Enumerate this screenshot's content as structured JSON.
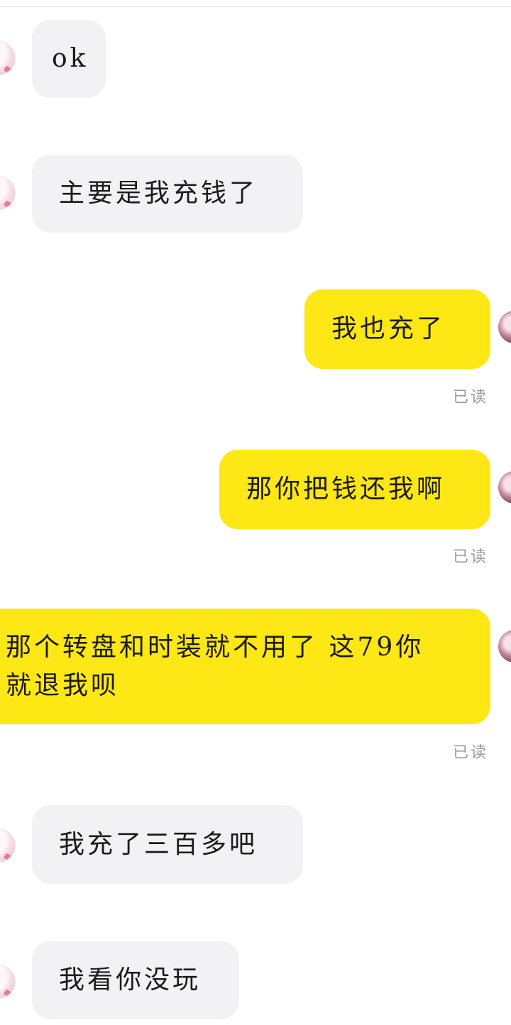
{
  "messages": [
    {
      "id": "m1",
      "side": "incoming",
      "text": "ok"
    },
    {
      "id": "m2",
      "side": "incoming",
      "text": "主要是我充钱了"
    },
    {
      "id": "m3",
      "side": "outgoing",
      "text": "我也充了",
      "status": "已读"
    },
    {
      "id": "m4",
      "side": "outgoing",
      "text": "那你把钱还我啊",
      "status": "已读"
    },
    {
      "id": "m5",
      "side": "outgoing",
      "text_line1": "那个转盘和时装就不用了 这79你",
      "text_line2": "就退我呗",
      "status": "已读"
    },
    {
      "id": "m6",
      "side": "incoming",
      "text": "我充了三百多吧"
    },
    {
      "id": "m7",
      "side": "incoming",
      "text": "我看你没玩"
    }
  ],
  "colors": {
    "incoming_bubble": "#f2f2f5",
    "outgoing_bubble": "#fde714",
    "read_receipt": "#9a9a9a",
    "background": "#ffffff"
  }
}
